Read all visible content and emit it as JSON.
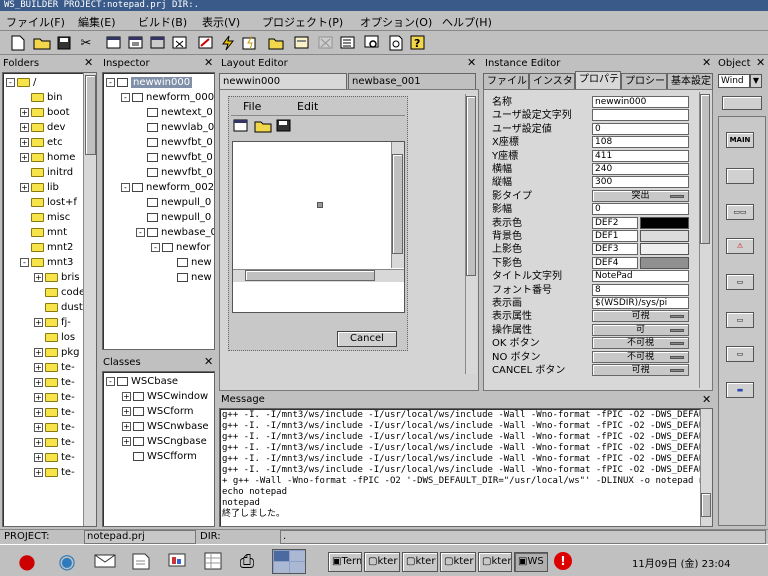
{
  "window_title": "WS_BUILDER PROJECT:notepad.prj DIR:.",
  "menu": [
    "ファイル(F)",
    "編集(E)",
    "ビルド(B)",
    "表示(V)",
    "プロジェクト(P)",
    "オプション(O)",
    "ヘルプ(H)"
  ],
  "toolbar_icons": [
    "new-file-icon",
    "open-folder-icon",
    "save-icon",
    "cut-icon",
    "copy-window-icon",
    "paste-window-icon",
    "window-icon",
    "delete-window-icon",
    "window-edit-icon",
    "build-icon",
    "compile-icon",
    "folder-icon",
    "window-icon",
    "disabled-icon",
    "list-icon",
    "find-icon",
    "preview-icon",
    "help-icon"
  ],
  "folders": {
    "title": "Folders",
    "close": "✕",
    "items": [
      {
        "name": "/",
        "exp": "-",
        "indent": 0
      },
      {
        "name": "bin",
        "exp": "",
        "indent": 1
      },
      {
        "name": "boot",
        "exp": "+",
        "indent": 1
      },
      {
        "name": "dev",
        "exp": "+",
        "indent": 1
      },
      {
        "name": "etc",
        "exp": "+",
        "indent": 1
      },
      {
        "name": "home",
        "exp": "+",
        "indent": 1
      },
      {
        "name": "initrd",
        "exp": "",
        "indent": 1
      },
      {
        "name": "lib",
        "exp": "+",
        "indent": 1
      },
      {
        "name": "lost+f",
        "exp": "",
        "indent": 1
      },
      {
        "name": "misc",
        "exp": "",
        "indent": 1
      },
      {
        "name": "mnt",
        "exp": "",
        "indent": 1
      },
      {
        "name": "mnt2",
        "exp": "",
        "indent": 1
      },
      {
        "name": "mnt3",
        "exp": "-",
        "indent": 1
      },
      {
        "name": "bris",
        "exp": "+",
        "indent": 2
      },
      {
        "name": "code",
        "exp": "",
        "indent": 2
      },
      {
        "name": "dust",
        "exp": "",
        "indent": 2
      },
      {
        "name": "fj-",
        "exp": "+",
        "indent": 2
      },
      {
        "name": "los",
        "exp": "",
        "indent": 2
      },
      {
        "name": "pkg",
        "exp": "+",
        "indent": 2
      },
      {
        "name": "te-",
        "exp": "+",
        "indent": 2
      },
      {
        "name": "te-",
        "exp": "+",
        "indent": 2
      },
      {
        "name": "te-",
        "exp": "+",
        "indent": 2
      },
      {
        "name": "te-",
        "exp": "+",
        "indent": 2
      },
      {
        "name": "te-",
        "exp": "+",
        "indent": 2
      },
      {
        "name": "te-",
        "exp": "+",
        "indent": 2
      },
      {
        "name": "te-",
        "exp": "+",
        "indent": 2
      },
      {
        "name": "te-",
        "exp": "+",
        "indent": 2
      }
    ]
  },
  "inspector": {
    "title": "Inspector",
    "close": "✕",
    "items": [
      {
        "name": "newwin000",
        "exp": "-",
        "indent": 0,
        "selected": true
      },
      {
        "name": "newform_000",
        "exp": "-",
        "indent": 1
      },
      {
        "name": "newtext_0",
        "exp": "",
        "indent": 2
      },
      {
        "name": "newvlab_0",
        "exp": "",
        "indent": 2
      },
      {
        "name": "newvfbt_0",
        "exp": "",
        "indent": 2
      },
      {
        "name": "newvfbt_0",
        "exp": "",
        "indent": 2
      },
      {
        "name": "newvfbt_0",
        "exp": "",
        "indent": 2
      },
      {
        "name": "newform_002",
        "exp": "-",
        "indent": 1
      },
      {
        "name": "newpull_0",
        "exp": "",
        "indent": 2
      },
      {
        "name": "newpull_0",
        "exp": "",
        "indent": 2
      },
      {
        "name": "newbase_0",
        "exp": "-",
        "indent": 2
      },
      {
        "name": "newfor",
        "exp": "-",
        "indent": 3
      },
      {
        "name": "new",
        "exp": "",
        "indent": 4
      },
      {
        "name": "new",
        "exp": "",
        "indent": 4
      }
    ]
  },
  "classes": {
    "title": "Classes",
    "close": "✕",
    "items": [
      {
        "name": "WSCbase",
        "exp": "-",
        "indent": 0
      },
      {
        "name": "WSCwindow",
        "exp": "+",
        "indent": 1
      },
      {
        "name": "WSCform",
        "exp": "+",
        "indent": 1
      },
      {
        "name": "WSCnwbase",
        "exp": "+",
        "indent": 1
      },
      {
        "name": "WSCngbase",
        "exp": "+",
        "indent": 1
      },
      {
        "name": "WSCfform",
        "exp": "",
        "indent": 1
      }
    ]
  },
  "layout": {
    "title": "Layout Editor",
    "close": "✕",
    "tabs": [
      "newwin000",
      "newbase_001"
    ],
    "menu": [
      "File",
      "Edit"
    ],
    "cancel": "Cancel"
  },
  "instance": {
    "title": "Instance Editor",
    "close": "✕",
    "tabs": [
      "ファイル",
      "インスタ",
      "プロパテ",
      "プロシー",
      "基本設定"
    ],
    "props": [
      {
        "name": "名称",
        "value": "newwin000",
        "kind": "text"
      },
      {
        "name": "ユーザ設定文字列",
        "value": "",
        "kind": "text"
      },
      {
        "name": "ユーザ設定値",
        "value": "0",
        "kind": "text"
      },
      {
        "name": "X座標",
        "value": "108",
        "kind": "text"
      },
      {
        "name": "Y座標",
        "value": "411",
        "kind": "text"
      },
      {
        "name": "横幅",
        "value": "240",
        "kind": "text"
      },
      {
        "name": "縦幅",
        "value": "300",
        "kind": "text"
      },
      {
        "name": "影タイプ",
        "value": "突出",
        "kind": "btn"
      },
      {
        "name": "影幅",
        "value": "0",
        "kind": "text"
      },
      {
        "name": "表示色",
        "value": "DEF2",
        "kind": "color",
        "swatch": "#000000"
      },
      {
        "name": "背景色",
        "value": "DEF1",
        "kind": "color",
        "swatch": "#dcdcdc"
      },
      {
        "name": "上影色",
        "value": "DEF3",
        "kind": "color",
        "swatch": "#f0f0f0"
      },
      {
        "name": "下影色",
        "value": "DEF4",
        "kind": "color",
        "swatch": "#909090"
      },
      {
        "name": "タイトル文字列",
        "value": "NotePad",
        "kind": "text"
      },
      {
        "name": "フォント番号",
        "value": "8",
        "kind": "text"
      },
      {
        "name": "表示画",
        "value": "$(WSDIR)/sys/pi",
        "kind": "text"
      },
      {
        "name": "表示属性",
        "value": "可視",
        "kind": "btn"
      },
      {
        "name": "操作属性",
        "value": "可",
        "kind": "btn"
      },
      {
        "name": "OK ボタン",
        "value": "不可視",
        "kind": "btn"
      },
      {
        "name": "NO ボタン",
        "value": "不可視",
        "kind": "btn"
      },
      {
        "name": "CANCEL ボタン",
        "value": "可視",
        "kind": "btn"
      }
    ]
  },
  "object": {
    "title": "Object",
    "close": "✕",
    "select": "Wind",
    "main_label": "MAIN"
  },
  "message": {
    "title": "Message",
    "close": "✕",
    "lines": [
      "g++ -I. -I/mnt3/ws/include -I/usr/local/ws/include  -Wall -Wno-format -fPIC -O2  -DWS_DEFAU",
      "g++ -I. -I/mnt3/ws/include -I/usr/local/ws/include  -Wall -Wno-format -fPIC -O2  -DWS_DEFAU",
      "g++ -I. -I/mnt3/ws/include -I/usr/local/ws/include  -Wall -Wno-format -fPIC -O2  -DWS_DEFAU",
      "g++ -I. -I/mnt3/ws/include -I/usr/local/ws/include  -Wall -Wno-format -fPIC -O2  -DWS_DEFAU",
      "g++ -I. -I/mnt3/ws/include -I/usr/local/ws/include  -Wall -Wno-format -fPIC -O2  -DWS_DEFAU",
      "g++ -I. -I/mnt3/ws/include -I/usr/local/ws/include  -Wall -Wno-format -fPIC -O2  -DWS_DEFAU",
      "+ g++ -Wall -Wno-format -fPIC -O2 '-DWS_DEFAULT_DIR=\"/usr/local/ws\"' -DLINUX -o notepad not",
      "echo notepad",
      "notepad",
      "終了しました。"
    ]
  },
  "status": {
    "project_label": "PROJECT:",
    "project_value": "notepad.prj",
    "dir_label": "DIR:",
    "dir_value": "."
  },
  "taskbar": {
    "items": [
      "Term",
      "kter",
      "kter",
      "kter",
      "kter",
      "WS B"
    ],
    "clock": "11月09日 (金) 23:04"
  }
}
